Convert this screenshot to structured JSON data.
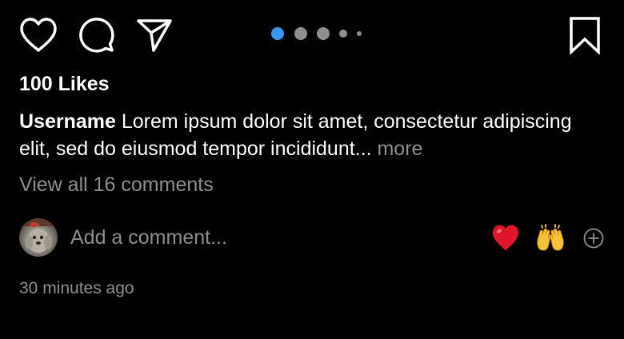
{
  "actions": {
    "icons": [
      "heart-outline-icon",
      "comment-bubble-icon",
      "paper-plane-icon",
      "bookmark-icon"
    ]
  },
  "carousel": {
    "count": 5,
    "active_index": 0,
    "active_color": "#3897f0",
    "inactive_color": "#8e8e8e"
  },
  "post": {
    "likes": "100 Likes",
    "username": "Username",
    "caption": "Lorem ipsum dolor sit amet, consectetur adipiscing elit, sed do eiusmod tempor incididunt...",
    "more_label": "more",
    "view_comments": "View all 16 comments",
    "timestamp": "30 minutes ago"
  },
  "comment_box": {
    "placeholder": "Add a comment...",
    "quick_reactions": [
      "❤️",
      "🙌"
    ]
  },
  "colors": {
    "background": "#000000",
    "text": "#ffffff",
    "muted": "#8e8e8e"
  }
}
